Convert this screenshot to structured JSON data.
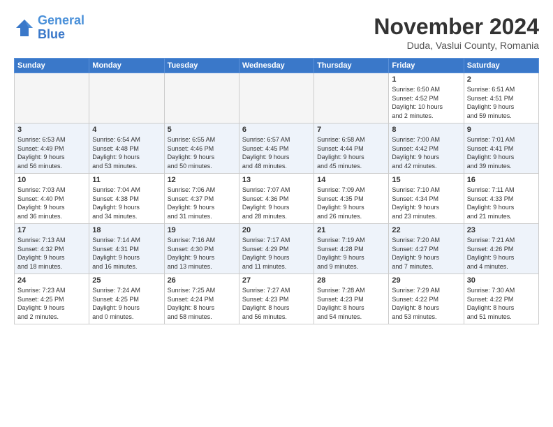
{
  "header": {
    "logo_line1": "General",
    "logo_line2": "Blue",
    "month_title": "November 2024",
    "location": "Duda, Vaslui County, Romania"
  },
  "weekdays": [
    "Sunday",
    "Monday",
    "Tuesday",
    "Wednesday",
    "Thursday",
    "Friday",
    "Saturday"
  ],
  "weeks": [
    [
      {
        "day": "",
        "info": ""
      },
      {
        "day": "",
        "info": ""
      },
      {
        "day": "",
        "info": ""
      },
      {
        "day": "",
        "info": ""
      },
      {
        "day": "",
        "info": ""
      },
      {
        "day": "1",
        "info": "Sunrise: 6:50 AM\nSunset: 4:52 PM\nDaylight: 10 hours\nand 2 minutes."
      },
      {
        "day": "2",
        "info": "Sunrise: 6:51 AM\nSunset: 4:51 PM\nDaylight: 9 hours\nand 59 minutes."
      }
    ],
    [
      {
        "day": "3",
        "info": "Sunrise: 6:53 AM\nSunset: 4:49 PM\nDaylight: 9 hours\nand 56 minutes."
      },
      {
        "day": "4",
        "info": "Sunrise: 6:54 AM\nSunset: 4:48 PM\nDaylight: 9 hours\nand 53 minutes."
      },
      {
        "day": "5",
        "info": "Sunrise: 6:55 AM\nSunset: 4:46 PM\nDaylight: 9 hours\nand 50 minutes."
      },
      {
        "day": "6",
        "info": "Sunrise: 6:57 AM\nSunset: 4:45 PM\nDaylight: 9 hours\nand 48 minutes."
      },
      {
        "day": "7",
        "info": "Sunrise: 6:58 AM\nSunset: 4:44 PM\nDaylight: 9 hours\nand 45 minutes."
      },
      {
        "day": "8",
        "info": "Sunrise: 7:00 AM\nSunset: 4:42 PM\nDaylight: 9 hours\nand 42 minutes."
      },
      {
        "day": "9",
        "info": "Sunrise: 7:01 AM\nSunset: 4:41 PM\nDaylight: 9 hours\nand 39 minutes."
      }
    ],
    [
      {
        "day": "10",
        "info": "Sunrise: 7:03 AM\nSunset: 4:40 PM\nDaylight: 9 hours\nand 36 minutes."
      },
      {
        "day": "11",
        "info": "Sunrise: 7:04 AM\nSunset: 4:38 PM\nDaylight: 9 hours\nand 34 minutes."
      },
      {
        "day": "12",
        "info": "Sunrise: 7:06 AM\nSunset: 4:37 PM\nDaylight: 9 hours\nand 31 minutes."
      },
      {
        "day": "13",
        "info": "Sunrise: 7:07 AM\nSunset: 4:36 PM\nDaylight: 9 hours\nand 28 minutes."
      },
      {
        "day": "14",
        "info": "Sunrise: 7:09 AM\nSunset: 4:35 PM\nDaylight: 9 hours\nand 26 minutes."
      },
      {
        "day": "15",
        "info": "Sunrise: 7:10 AM\nSunset: 4:34 PM\nDaylight: 9 hours\nand 23 minutes."
      },
      {
        "day": "16",
        "info": "Sunrise: 7:11 AM\nSunset: 4:33 PM\nDaylight: 9 hours\nand 21 minutes."
      }
    ],
    [
      {
        "day": "17",
        "info": "Sunrise: 7:13 AM\nSunset: 4:32 PM\nDaylight: 9 hours\nand 18 minutes."
      },
      {
        "day": "18",
        "info": "Sunrise: 7:14 AM\nSunset: 4:31 PM\nDaylight: 9 hours\nand 16 minutes."
      },
      {
        "day": "19",
        "info": "Sunrise: 7:16 AM\nSunset: 4:30 PM\nDaylight: 9 hours\nand 13 minutes."
      },
      {
        "day": "20",
        "info": "Sunrise: 7:17 AM\nSunset: 4:29 PM\nDaylight: 9 hours\nand 11 minutes."
      },
      {
        "day": "21",
        "info": "Sunrise: 7:19 AM\nSunset: 4:28 PM\nDaylight: 9 hours\nand 9 minutes."
      },
      {
        "day": "22",
        "info": "Sunrise: 7:20 AM\nSunset: 4:27 PM\nDaylight: 9 hours\nand 7 minutes."
      },
      {
        "day": "23",
        "info": "Sunrise: 7:21 AM\nSunset: 4:26 PM\nDaylight: 9 hours\nand 4 minutes."
      }
    ],
    [
      {
        "day": "24",
        "info": "Sunrise: 7:23 AM\nSunset: 4:25 PM\nDaylight: 9 hours\nand 2 minutes."
      },
      {
        "day": "25",
        "info": "Sunrise: 7:24 AM\nSunset: 4:25 PM\nDaylight: 9 hours\nand 0 minutes."
      },
      {
        "day": "26",
        "info": "Sunrise: 7:25 AM\nSunset: 4:24 PM\nDaylight: 8 hours\nand 58 minutes."
      },
      {
        "day": "27",
        "info": "Sunrise: 7:27 AM\nSunset: 4:23 PM\nDaylight: 8 hours\nand 56 minutes."
      },
      {
        "day": "28",
        "info": "Sunrise: 7:28 AM\nSunset: 4:23 PM\nDaylight: 8 hours\nand 54 minutes."
      },
      {
        "day": "29",
        "info": "Sunrise: 7:29 AM\nSunset: 4:22 PM\nDaylight: 8 hours\nand 53 minutes."
      },
      {
        "day": "30",
        "info": "Sunrise: 7:30 AM\nSunset: 4:22 PM\nDaylight: 8 hours\nand 51 minutes."
      }
    ]
  ]
}
